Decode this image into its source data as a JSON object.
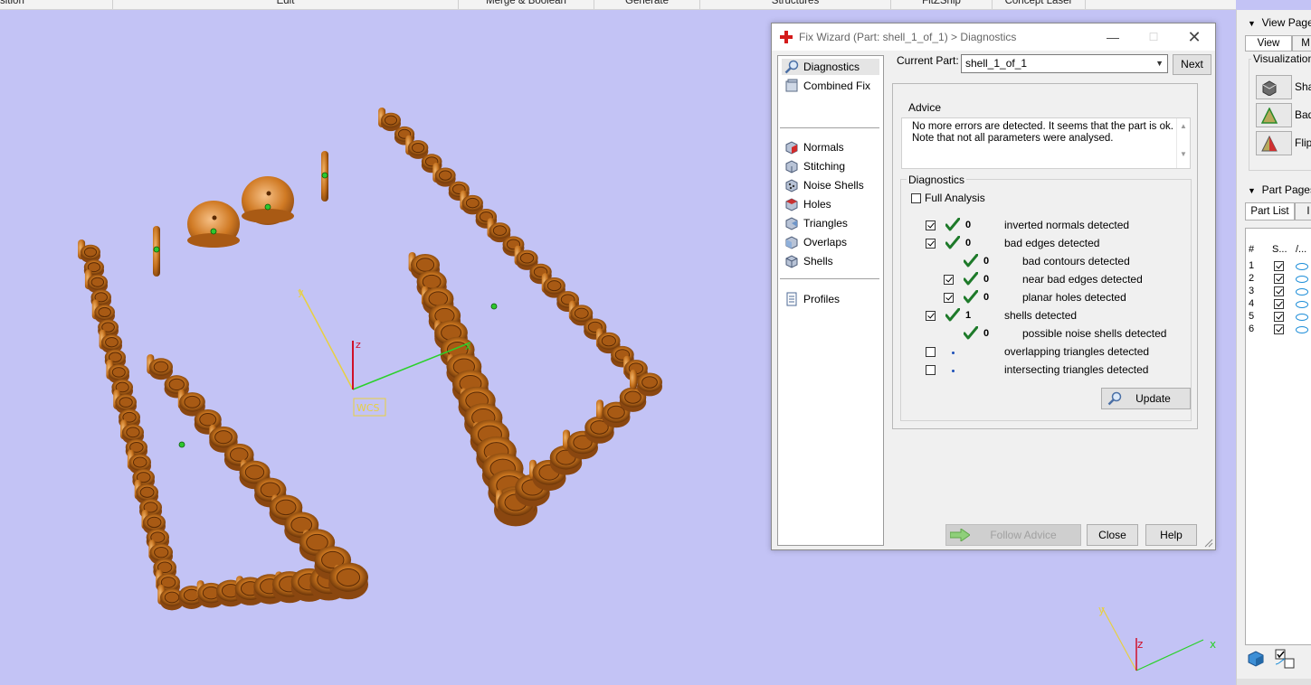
{
  "menu": [
    "sition",
    "Edit",
    "Merge & Boolean",
    "Generate",
    "Structures",
    "FitZShip",
    "Concept Laser"
  ],
  "viewport": {
    "wcs_label": "WCS",
    "axis_z_label": "z",
    "axis_y_label": "y",
    "axis_x_label": "x",
    "mini_axis_z": "z",
    "mini_axis_x": "x",
    "mini_axis_y": "y",
    "colors": {
      "background": "#c3c3f5",
      "parts": "#c8741e",
      "axis_x": "#2ad12a",
      "axis_y": "#e8d040",
      "axis_z": "#d0102a"
    }
  },
  "dialog": {
    "title": "Fix Wizard (Part: shell_1_of_1) > Diagnostics",
    "nav": {
      "items_top": [
        "Diagnostics",
        "Combined Fix"
      ],
      "items_fix": [
        "Normals",
        "Stitching",
        "Noise Shells",
        "Holes",
        "Triangles",
        "Overlaps",
        "Shells"
      ],
      "items_bottom": [
        "Profiles"
      ],
      "selected": "Diagnostics"
    },
    "current_part_label": "Current Part:",
    "current_part_value": "shell_1_of_1",
    "next_label": "Next",
    "advice_label": "Advice",
    "advice_text_1": "No more errors are detected. It seems that the part is ok.",
    "advice_text_2": "Note that not all parameters were analysed.",
    "diagnostics_label": "Diagnostics",
    "full_analysis_label": "Full Analysis",
    "full_analysis_checked": false,
    "rows": [
      {
        "checked": true,
        "status": "ok",
        "count": "0",
        "label": "inverted normals detected"
      },
      {
        "checked": true,
        "status": "ok",
        "count": "0",
        "label": "bad edges detected"
      },
      {
        "checked": null,
        "status": "ok",
        "count": "0",
        "label": "bad contours detected"
      },
      {
        "checked": true,
        "status": "ok",
        "count": "0",
        "label": "near bad edges detected"
      },
      {
        "checked": true,
        "status": "ok",
        "count": "0",
        "label": "planar holes detected"
      },
      {
        "checked": true,
        "status": "ok",
        "count": "1",
        "label": "shells detected"
      },
      {
        "checked": null,
        "status": "ok",
        "count": "0",
        "label": "possible noise shells detected"
      },
      {
        "checked": false,
        "status": "pending",
        "count": "",
        "label": "overlapping triangles detected"
      },
      {
        "checked": false,
        "status": "pending",
        "count": "",
        "label": "intersecting triangles detected"
      }
    ],
    "update_label": "Update",
    "follow_advice_label": "Follow Advice",
    "close_label": "Close",
    "help_label": "Help"
  },
  "right_panel": {
    "view_pages_label": "View Pages",
    "tabs": [
      "View",
      "M"
    ],
    "visualization_label": "Visualization",
    "vis_buttons": [
      "Sha",
      "Bad",
      "Flipp"
    ],
    "part_pages_label": "Part Pages",
    "part_tabs": [
      "Part List",
      "I"
    ],
    "columns": [
      "#",
      "S...",
      "/..."
    ],
    "part_rows": [
      "1",
      "2",
      "3",
      "4",
      "5",
      "6"
    ]
  }
}
